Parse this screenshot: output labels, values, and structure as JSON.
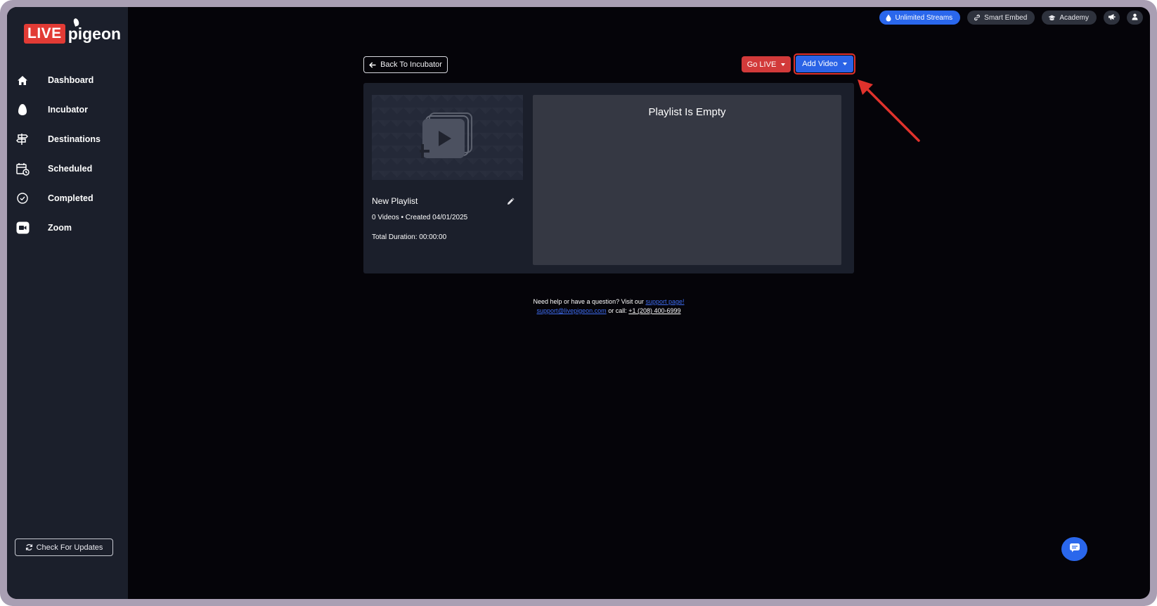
{
  "brand": {
    "live": "LIVE",
    "pigeon": "pigeon",
    "accent": "#e23b35"
  },
  "sidebar": {
    "items": [
      {
        "label": "Dashboard",
        "icon": "home-icon"
      },
      {
        "label": "Incubator",
        "icon": "egg-icon"
      },
      {
        "label": "Destinations",
        "icon": "signpost-icon"
      },
      {
        "label": "Scheduled",
        "icon": "calendar-clock-icon"
      },
      {
        "label": "Completed",
        "icon": "check-circle-icon"
      },
      {
        "label": "Zoom",
        "icon": "video-camera-icon"
      }
    ],
    "check_updates": "Check For Updates"
  },
  "topbar": {
    "unlimited_streams": "Unlimited Streams",
    "smart_embed": "Smart Embed",
    "academy": "Academy",
    "announcements_icon": "megaphone-icon",
    "profile_icon": "user-icon"
  },
  "toolbar": {
    "back": "Back To Incubator",
    "go_live": "Go LIVE",
    "add_video": "Add Video"
  },
  "playlist": {
    "title": "New Playlist",
    "meta": "0 Videos • Created 04/01/2025",
    "duration": "Total Duration: 00:00:00",
    "empty_message": "Playlist Is Empty"
  },
  "help": {
    "line1_prefix": "Need help or have a question? Visit our",
    "support_link": "support page!",
    "email": "support@livepigeon.com",
    "or_call": "or call:",
    "phone": "+1 (208) 400-6999"
  },
  "colors": {
    "primary_blue": "#2b63e6",
    "go_live_red": "#d23a3a",
    "annotation_red": "#e0322c",
    "sidebar_bg": "#1b1f2b",
    "main_bg": "#050409"
  }
}
